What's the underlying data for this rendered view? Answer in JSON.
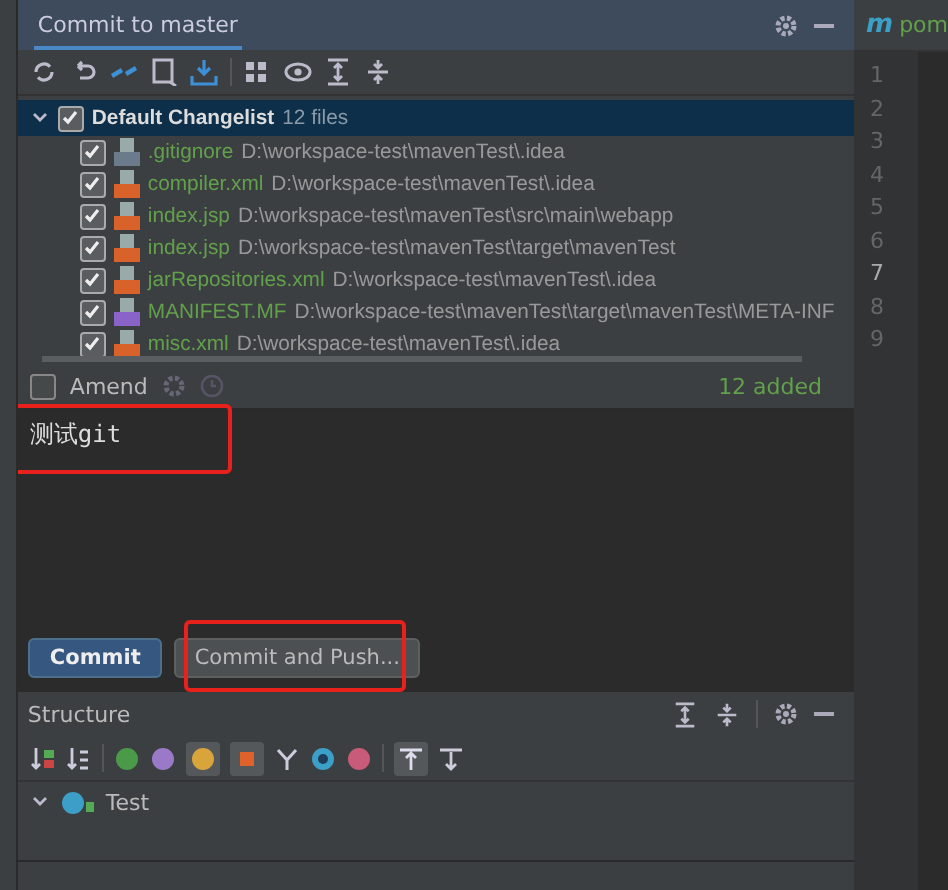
{
  "header": {
    "title": "Commit to master"
  },
  "editor_tab": {
    "icon": "m",
    "title": "pom"
  },
  "line_numbers": [
    "1",
    "2",
    "3",
    "4",
    "5",
    "6",
    "7",
    "8",
    "9"
  ],
  "changelist": {
    "name": "Default Changelist",
    "count": "12 files",
    "checked": true,
    "expanded": true,
    "files": [
      {
        "name": ".gitignore",
        "path": "D:\\workspace-test\\mavenTest\\.idea",
        "checked": true,
        "kind": "ignore"
      },
      {
        "name": "compiler.xml",
        "path": "D:\\workspace-test\\mavenTest\\.idea",
        "checked": true,
        "kind": "xml"
      },
      {
        "name": "index.jsp",
        "path": "D:\\workspace-test\\mavenTest\\src\\main\\webapp",
        "checked": true,
        "kind": "jsp"
      },
      {
        "name": "index.jsp",
        "path": "D:\\workspace-test\\mavenTest\\target\\mavenTest",
        "checked": true,
        "kind": "jsp"
      },
      {
        "name": "jarRepositories.xml",
        "path": "D:\\workspace-test\\mavenTest\\.idea",
        "checked": true,
        "kind": "xml"
      },
      {
        "name": "MANIFEST.MF",
        "path": "D:\\workspace-test\\mavenTest\\target\\mavenTest\\META-INF",
        "checked": true,
        "kind": "mf"
      },
      {
        "name": "misc.xml",
        "path": "D:\\workspace-test\\mavenTest\\.idea",
        "checked": true,
        "kind": "xml"
      }
    ]
  },
  "amend": {
    "label": "Amend",
    "checked": false
  },
  "added": "12 added",
  "message": {
    "value": "测试git"
  },
  "buttons": [
    {
      "label": "Commit",
      "primary": true
    },
    {
      "label": "Commit and Push...",
      "primary": false
    }
  ],
  "structure": {
    "title": "Structure",
    "tree": [
      {
        "name": "Test",
        "expanded": true
      }
    ]
  }
}
